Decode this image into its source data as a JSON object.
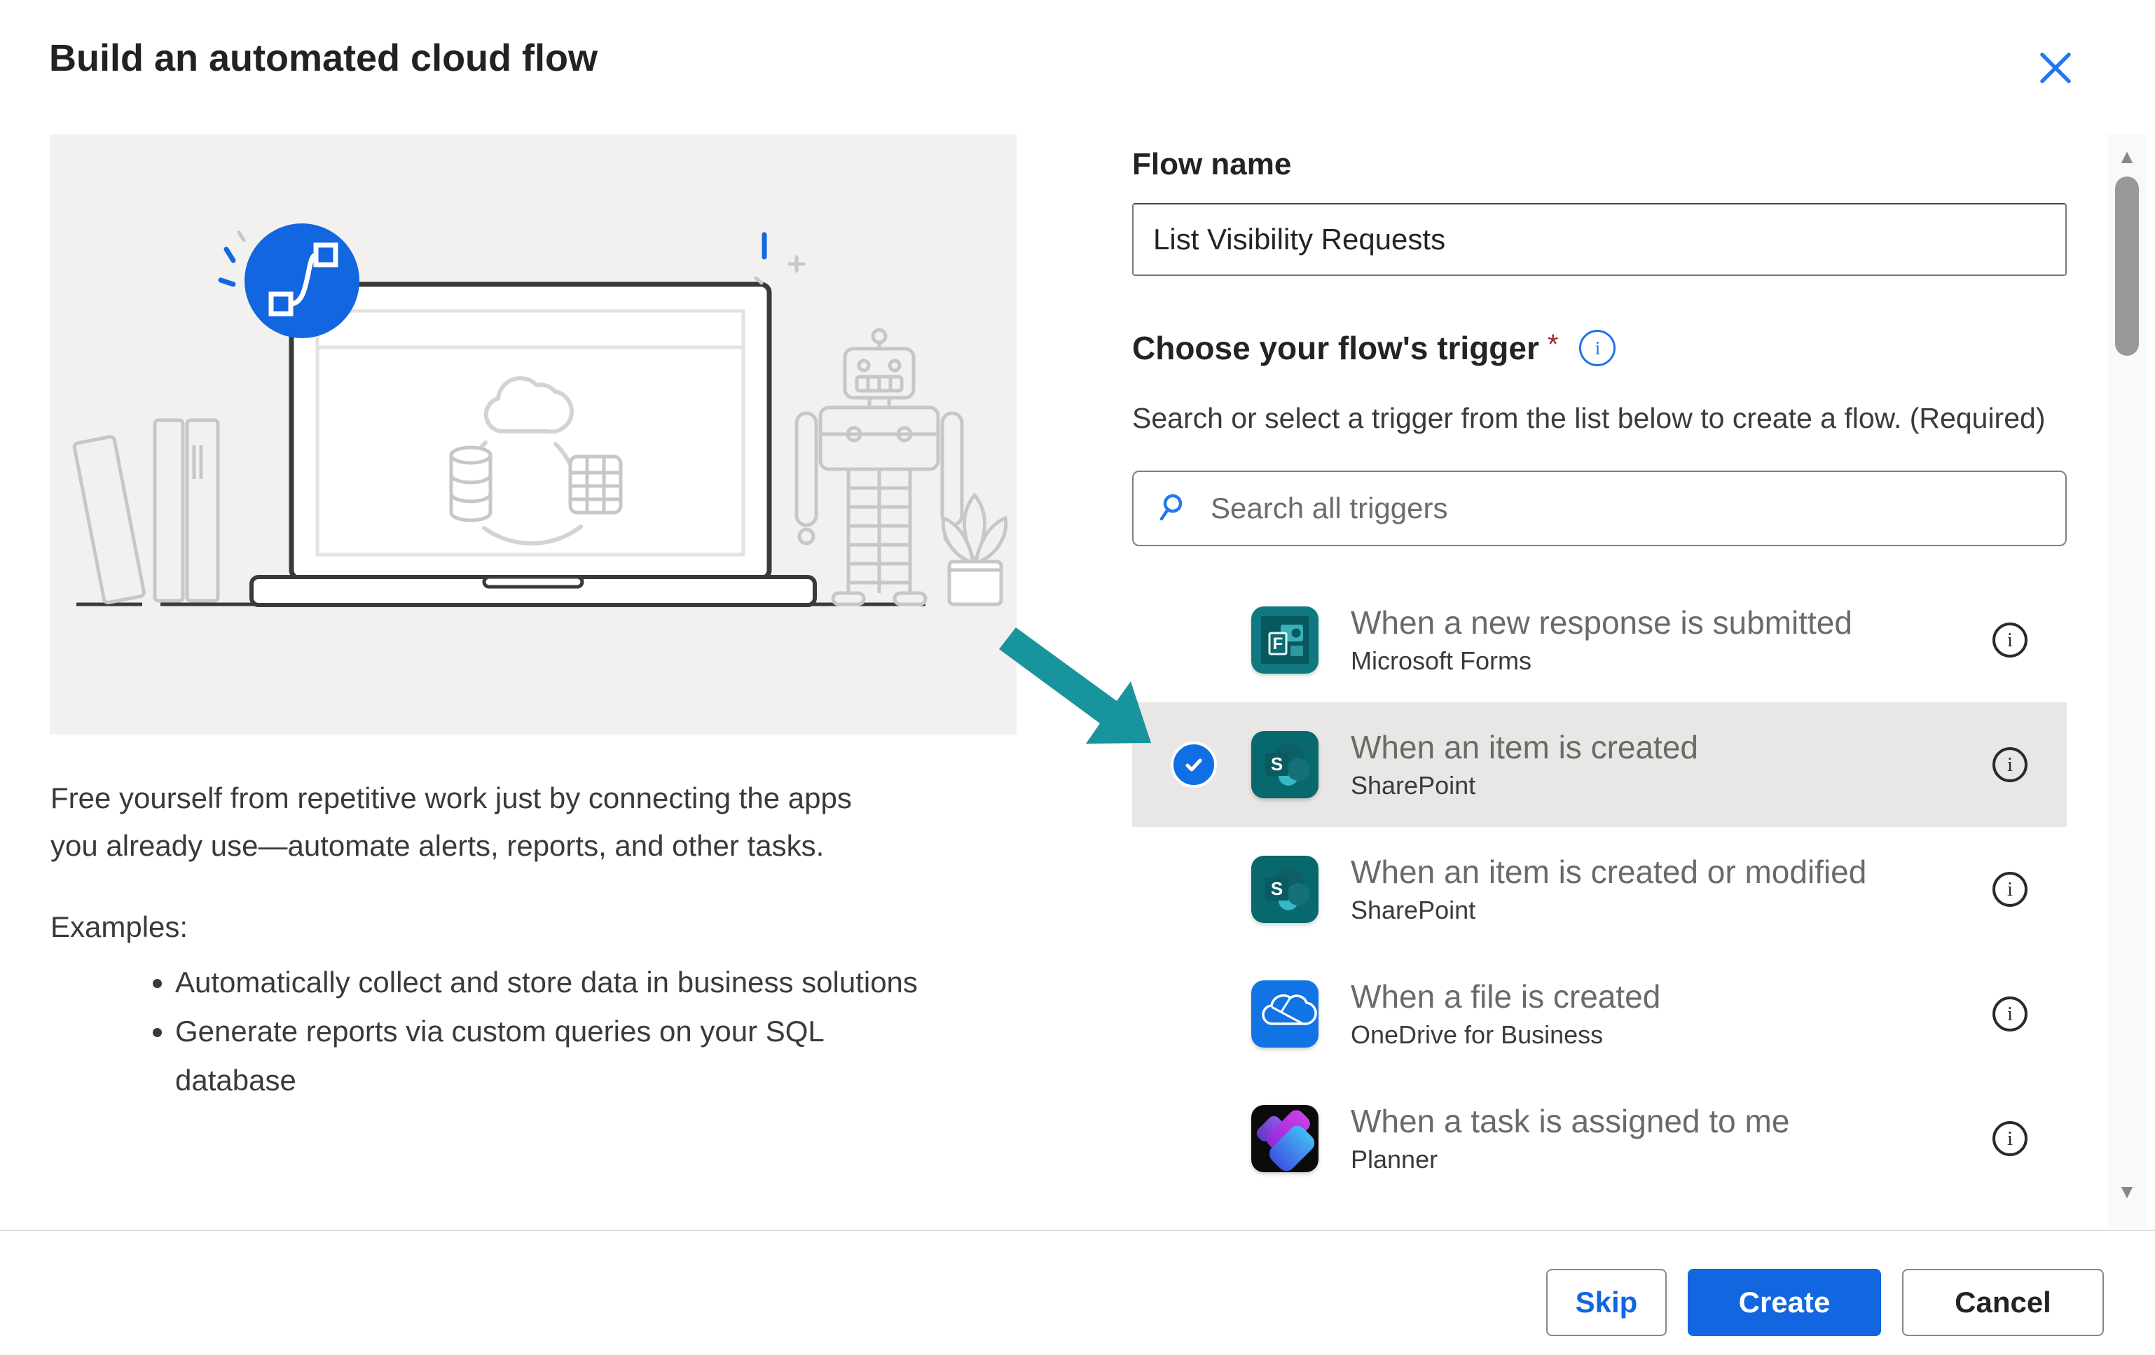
{
  "dialog": {
    "title": "Build an automated cloud flow"
  },
  "left_panel": {
    "description": "Free yourself from repetitive work just by connecting the apps\nyou already use—automate alerts, reports, and other tasks.",
    "examples_label": "Examples:",
    "examples": [
      "Automatically collect and store data in business solutions",
      "Generate reports via custom queries on your SQL\ndatabase"
    ]
  },
  "form": {
    "flow_name_label": "Flow name",
    "flow_name_value": "List Visibility Requests",
    "trigger_heading": "Choose your flow's trigger",
    "required_marker": "*",
    "trigger_help": "Search or select a trigger from the list below to create a flow. (Required)",
    "search_placeholder": "Search all triggers"
  },
  "triggers": [
    {
      "title": "When a new response is submitted",
      "app": "Microsoft Forms",
      "selected": false
    },
    {
      "title": "When an item is created",
      "app": "SharePoint",
      "selected": true
    },
    {
      "title": "When an item is created or modified",
      "app": "SharePoint",
      "selected": false
    },
    {
      "title": "When a file is created",
      "app": "OneDrive for Business",
      "selected": false
    },
    {
      "title": "When a task is assigned to me",
      "app": "Planner",
      "selected": false
    }
  ],
  "footer": {
    "skip_label": "Skip",
    "create_label": "Create",
    "cancel_label": "Cancel"
  },
  "icons": {
    "info": "i",
    "scroll_up": "▲",
    "scroll_down": "▼"
  },
  "colors": {
    "accent_blue": "#1267E0",
    "check_blue": "#0F6FE5",
    "close_x_blue": "#2478EE",
    "required_red": "#A4262C",
    "arrow_teal": "#18949C",
    "selected_row_bg": "#E9E7E5",
    "forms_teal": "#0F7880",
    "sharepoint_teal": "#07686E",
    "onedrive_blue": "#1173E4",
    "planner_black": "#0B0B0C",
    "illustration_bg": "#F2F1EF"
  }
}
